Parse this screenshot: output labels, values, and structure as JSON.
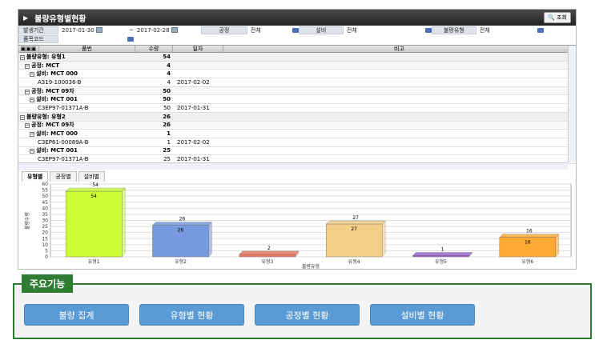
{
  "window": {
    "title": "불량유형별현황",
    "query_button": "조회"
  },
  "filters": {
    "period_label": "발생기간",
    "date_from": "2017-01-30",
    "date_sep": "~",
    "date_to": "2017-02-28",
    "process_label": "공정",
    "process_value": "전체",
    "equipment_label": "설비",
    "equipment_value": "전체",
    "defect_type_label": "불량유형",
    "defect_type_value": "전체",
    "item_code_label": "품목코드"
  },
  "grid": {
    "columns": [
      "품번",
      "수량",
      "일자",
      "비고"
    ],
    "rows": [
      {
        "level": 0,
        "text": "불량유형: 유형1",
        "qty": "54",
        "date": ""
      },
      {
        "level": 1,
        "text": "공정: MCT",
        "qty": "4",
        "date": ""
      },
      {
        "level": 2,
        "text": "설비: MCT 000",
        "qty": "4",
        "date": ""
      },
      {
        "level": 3,
        "text": "A319-100036-B",
        "qty": "4",
        "date": "2017-02-02"
      },
      {
        "level": 1,
        "text": "공정: MCT 09차",
        "qty": "50",
        "date": ""
      },
      {
        "level": 2,
        "text": "설비: MCT 001",
        "qty": "50",
        "date": ""
      },
      {
        "level": 3,
        "text": "C3EP97-01371A-B",
        "qty": "50",
        "date": "2017-01-31"
      },
      {
        "level": 0,
        "text": "불량유형: 유형2",
        "qty": "26",
        "date": ""
      },
      {
        "level": 1,
        "text": "공정: MCT 09차",
        "qty": "26",
        "date": ""
      },
      {
        "level": 2,
        "text": "설비: MCT 000",
        "qty": "1",
        "date": ""
      },
      {
        "level": 3,
        "text": "C3EP61-00089A-B",
        "qty": "1",
        "date": "2017-02-02"
      },
      {
        "level": 2,
        "text": "설비: MCT 001",
        "qty": "25",
        "date": ""
      },
      {
        "level": 3,
        "text": "C3EP97-01371A-B",
        "qty": "25",
        "date": "2017-01-31"
      }
    ]
  },
  "tabs": [
    "유형별",
    "공정별",
    "설비별"
  ],
  "chart_data": {
    "type": "bar",
    "categories": [
      "유형1",
      "유형2",
      "유형3",
      "유형4",
      "유형5",
      "유형6"
    ],
    "values": [
      54,
      26,
      2,
      27,
      1,
      16
    ],
    "colors": [
      "#ccff33",
      "#7799dd",
      "#ee7766",
      "#f3cf88",
      "#9966cc",
      "#ffaa33"
    ],
    "xlabel": "불량유형",
    "ylabel": "불량수량",
    "ylim": [
      0,
      60
    ],
    "yticks": [
      0,
      5,
      10,
      15,
      20,
      25,
      30,
      35,
      40,
      45,
      50,
      55,
      60
    ]
  },
  "features": {
    "title": "주요기능",
    "buttons": [
      "불량 집계",
      "유형별 현황",
      "공정별 현황",
      "설비별 현황"
    ]
  }
}
